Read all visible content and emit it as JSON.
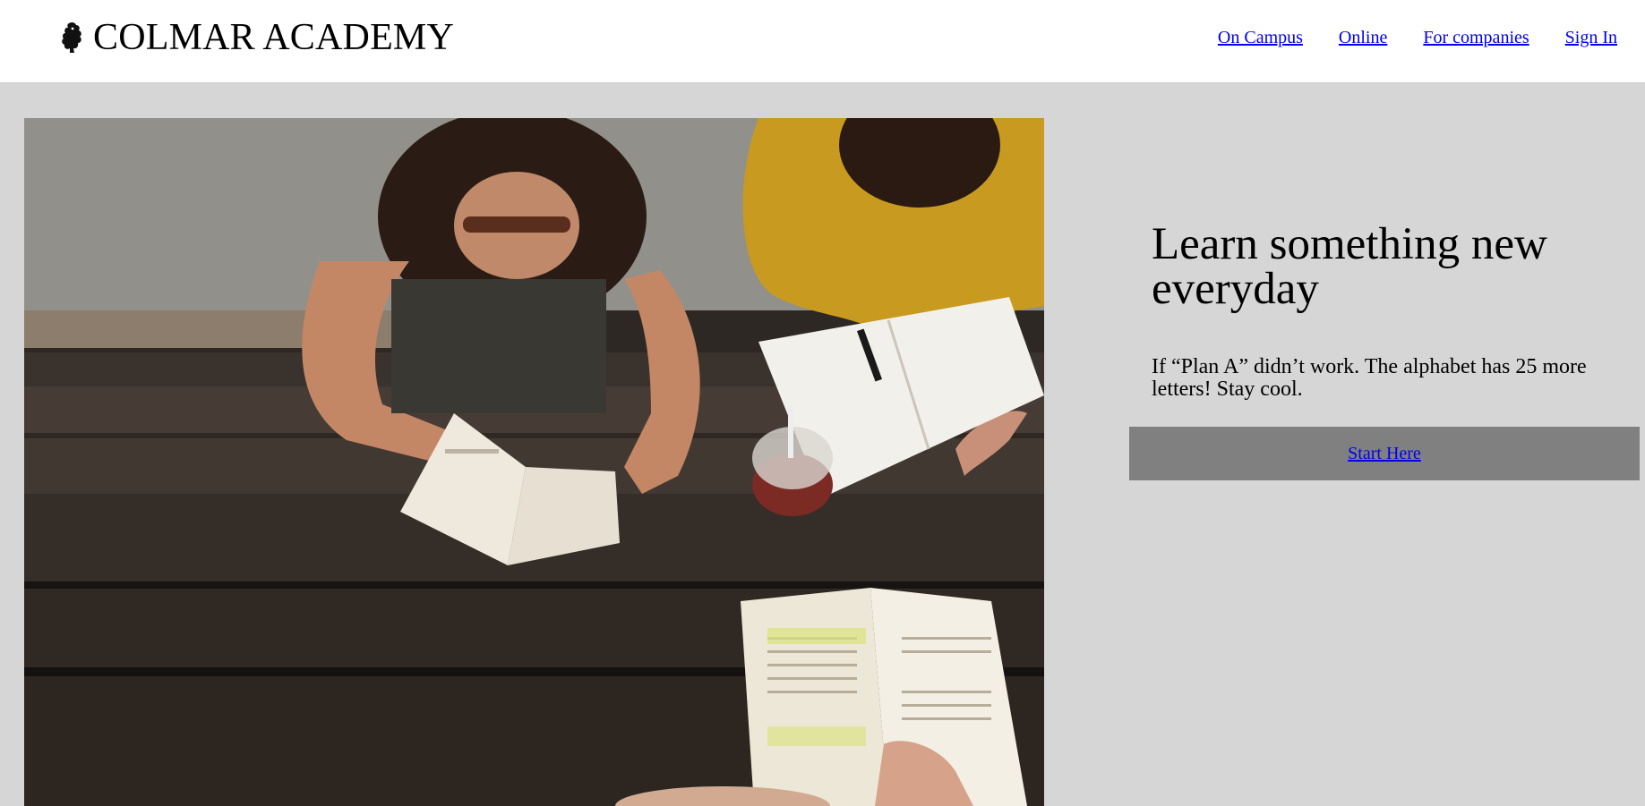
{
  "header": {
    "brand_icon": "lion-rampant-icon",
    "brand_name": "COLMAR ACADEMY",
    "nav": [
      {
        "label": "On Campus"
      },
      {
        "label": "Online"
      },
      {
        "label": "For companies"
      },
      {
        "label": "Sign In"
      }
    ]
  },
  "hero": {
    "image": "students-studying-at-wooden-table-photo",
    "title": "Learn something new everyday",
    "subtitle": "If “Plan A” didn’t work. The alphabet has 25 more letters! Stay cool.",
    "cta_label": "Start Here"
  },
  "colors": {
    "background": "#d6d6d6",
    "header_bg": "#ffffff",
    "cta_bg": "#808080",
    "link": "#0000ee"
  }
}
